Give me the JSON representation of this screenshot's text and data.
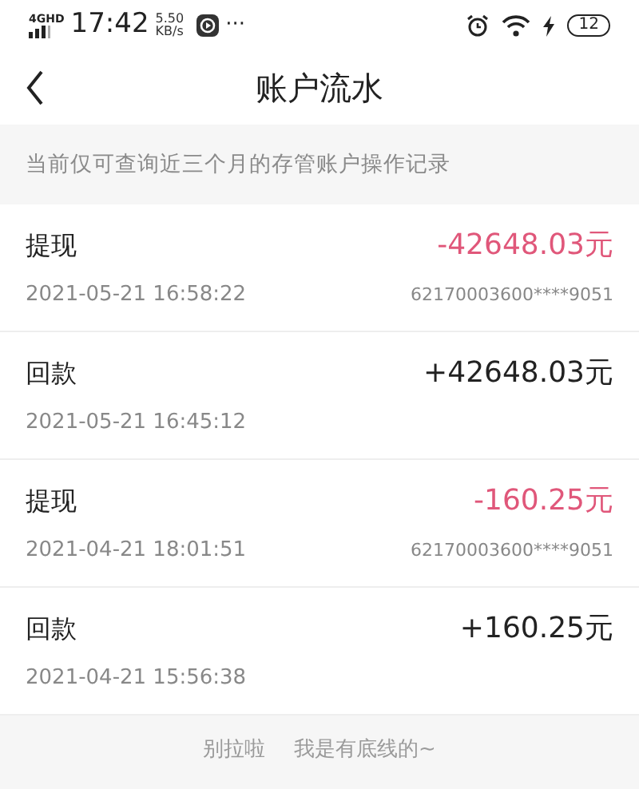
{
  "status_bar": {
    "network": "4GHD",
    "time": "17:42",
    "speed": "5.50",
    "speed_unit": "KB/s",
    "more": "···",
    "battery": "12"
  },
  "header": {
    "title": "账户流水"
  },
  "notice": "当前仅可查询近三个月的存管账户操作记录",
  "records": [
    {
      "kind": "withdraw",
      "type": "提现",
      "amount": "-42648.03元",
      "time": "2021-05-21 16:58:22",
      "account": "62170003600****9051"
    },
    {
      "kind": "deposit",
      "type": "回款",
      "amount": "+42648.03元",
      "time": "2021-05-21 16:45:12"
    },
    {
      "kind": "withdraw",
      "type": "提现",
      "amount": "-160.25元",
      "time": "2021-04-21 18:01:51",
      "account": "62170003600****9051"
    },
    {
      "kind": "deposit",
      "type": "回款",
      "amount": "+160.25元",
      "time": "2021-04-21 15:56:38"
    }
  ],
  "footer": [
    "别拉啦",
    "我是有底线的~"
  ]
}
